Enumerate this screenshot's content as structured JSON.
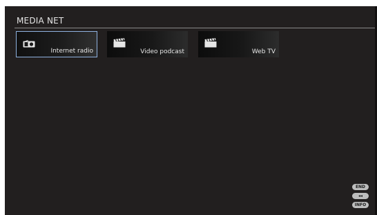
{
  "header": {
    "title": "MEDIA NET"
  },
  "tiles": [
    {
      "label": "Internet radio",
      "icon": "radio-icon",
      "selected": true
    },
    {
      "label": "Video podcast",
      "icon": "clapperboard-icon",
      "selected": false
    },
    {
      "label": "Web TV",
      "icon": "clapperboard-icon",
      "selected": false
    }
  ],
  "hints": {
    "end_label": "END",
    "back_label": "◂◂",
    "info_label": "INFO"
  },
  "colors": {
    "background": "#221f1f",
    "selection_border": "#8fb2e0",
    "text": "#e8e8e8"
  }
}
